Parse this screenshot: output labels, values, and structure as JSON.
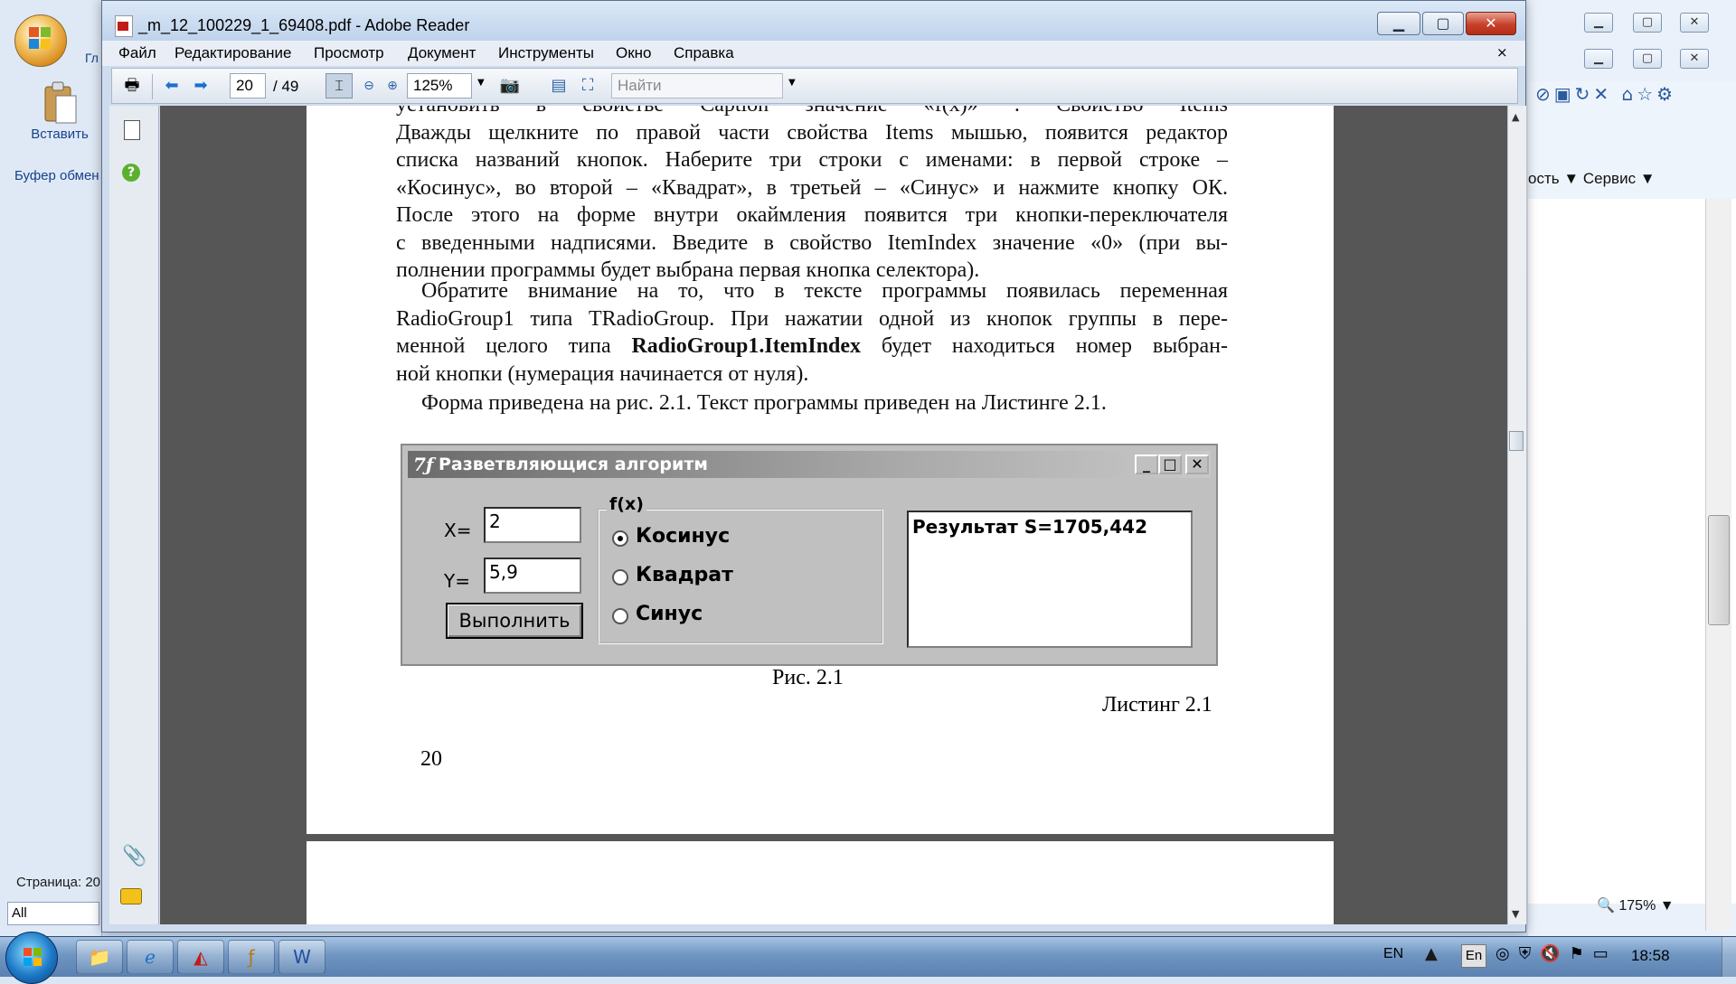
{
  "background": {
    "word_tab_label": "Гл",
    "paste_label": "Вставить",
    "clipboard_group_label": "Буфер обмен",
    "status_page": "Страница: 20",
    "all_field": "All",
    "ie_menu": "ость ▼   Сервис ▼",
    "zoom_readout": "175%"
  },
  "reader": {
    "title": "_m_12_100229_1_69408.pdf - Adobe Reader",
    "buttons": {
      "minimize": "▁",
      "maximize": "▢",
      "close": "✕"
    },
    "menu": [
      "Файл",
      "Редактирование",
      "Просмотр",
      "Документ",
      "Инструменты",
      "Окно",
      "Справка"
    ],
    "doc_close": "×",
    "toolbar": {
      "page_number": "20",
      "page_total": "/ 49",
      "zoom": "125%",
      "find_placeholder": "Найти"
    }
  },
  "pdf": {
    "paragraph1_lines": [
      "установить в свойстве Caption значение «f(x)» . Свойство Items",
      "Дважды щелкните по правой части свойства Items мышью, появится редактор",
      "списка названий кнопок. Наберите три строки с именами: в первой строке –",
      "«Косинус», во второй – «Квадрат», в третьей – «Синус» и нажмите кнопку ОК.",
      "После этого на форме внутри окаймления появится три кнопки-переключателя",
      "с введенными надписями. Введите в свойство ItemIndex значение «0» (при вы-",
      "полнении программы будет выбрана первая кнопка селектора)."
    ],
    "paragraph2_lines": [
      "Обратите внимание на то, что в тексте программы появилась переменная",
      "RadioGroup1 типа TRadioGroup. При нажатии одной из кнопок группы в пере-"
    ],
    "paragraph2_line3_before": "менной целого типа ",
    "paragraph2_line3_bold": "RadioGroup1.ItemIndex",
    "paragraph2_line3_after": " будет находиться номер выбран-",
    "paragraph2_line4": "ной кнопки (нумерация начинается от нуля).",
    "paragraph3": "Форма приведена на рис. 2.1. Текст программы приведен на Листинге 2.1.",
    "figure_caption": "Рис. 2.1",
    "listing_caption": "Листинг 2.1",
    "page_number": "20"
  },
  "form": {
    "title": "Разветвляющися алгоритм",
    "icon_text": "7ƒ",
    "x_label": "X=",
    "x_value": "2",
    "y_label": "Y=",
    "y_value": "5,9",
    "run_button": "Выполнить",
    "group_caption": "f(x)",
    "options": [
      "Косинус",
      "Квадрат",
      "Синус"
    ],
    "selected_option": 0,
    "result": "Результат S=1705,442"
  },
  "taskbar": {
    "language": "EN",
    "tray_lang_box": "En",
    "clock": "18:58"
  },
  "colors": {
    "pdf_accent": "#c21b17",
    "titlebar": "#bfd3ec",
    "close_button": "#c7412a"
  }
}
